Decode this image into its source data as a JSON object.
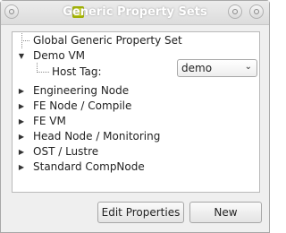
{
  "window": {
    "title": "Generic Property Sets"
  },
  "tree": {
    "items": [
      {
        "label": "Global Generic Property Set",
        "expander": ""
      },
      {
        "label": "Demo VM",
        "expander": "▼"
      },
      {
        "label": "Host Tag:",
        "expander": ""
      },
      {
        "label": "Engineering Node",
        "expander": "▶"
      },
      {
        "label": "FE Node / Compile",
        "expander": "▶"
      },
      {
        "label": "FE VM",
        "expander": "▶"
      },
      {
        "label": "Head Node / Monitoring",
        "expander": "▶"
      },
      {
        "label": "OST / Lustre",
        "expander": "▶"
      },
      {
        "label": "Standard CompNode",
        "expander": "▶"
      }
    ],
    "host_tag_value": "demo",
    "dropdown_icon": "chevron-down-icon"
  },
  "buttons": {
    "edit_label": "Edit Properties",
    "new_label": "New"
  }
}
